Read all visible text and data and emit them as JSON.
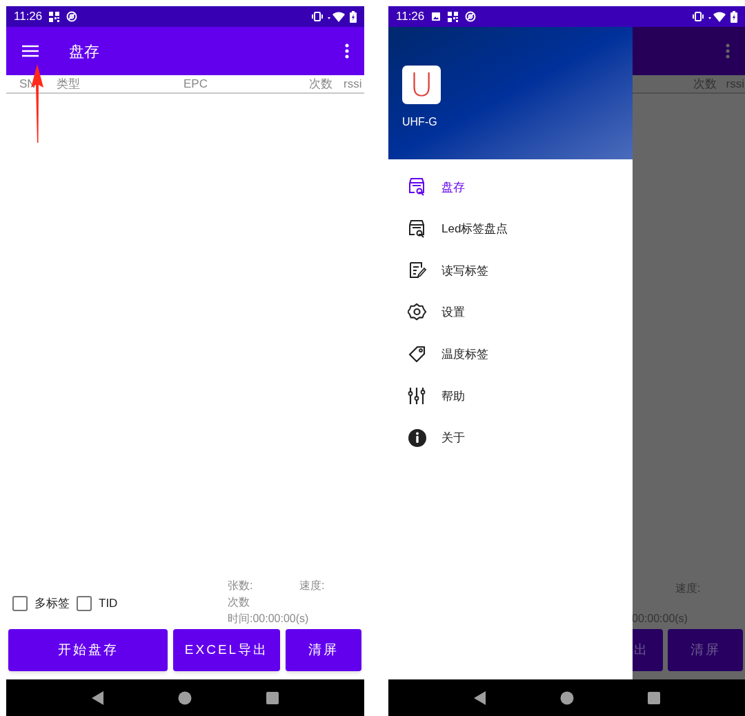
{
  "main_screen": {
    "status_bar": {
      "time": "11:26"
    },
    "title": "盘存",
    "columns": [
      "SN",
      "类型",
      "EPC",
      "次数",
      "rssi"
    ],
    "checkboxes": [
      {
        "label": "多标签",
        "checked": false
      },
      {
        "label": "TID",
        "checked": false
      }
    ],
    "stats": {
      "count": "张数:",
      "speed": "速度:",
      "times": "次数",
      "time": "时间:00:00:00(s)"
    },
    "buttons": [
      "开始盘存",
      "EXCEL导出",
      "清屏"
    ]
  },
  "drawer_screen": {
    "status_bar": {
      "time": "11:26"
    },
    "app_name": "UHF-G",
    "logo_letter": "U",
    "menu": [
      {
        "label": "盘存",
        "kind": "inventory",
        "selected": true
      },
      {
        "label": "Led标签盘点",
        "kind": "inventory",
        "selected": false
      },
      {
        "label": "读写标签",
        "kind": "edit",
        "selected": false
      },
      {
        "label": "设置",
        "kind": "settings",
        "selected": false
      },
      {
        "label": "温度标签",
        "kind": "tag",
        "selected": false
      },
      {
        "label": "帮助",
        "kind": "sliders",
        "selected": false
      },
      {
        "label": "关于",
        "kind": "info",
        "selected": false
      }
    ],
    "behind": {
      "columns": [
        "次数",
        "rssi"
      ],
      "speed": "速度:",
      "time": "00:00:00(s)",
      "buttons": [
        "出",
        "清屏"
      ]
    }
  }
}
